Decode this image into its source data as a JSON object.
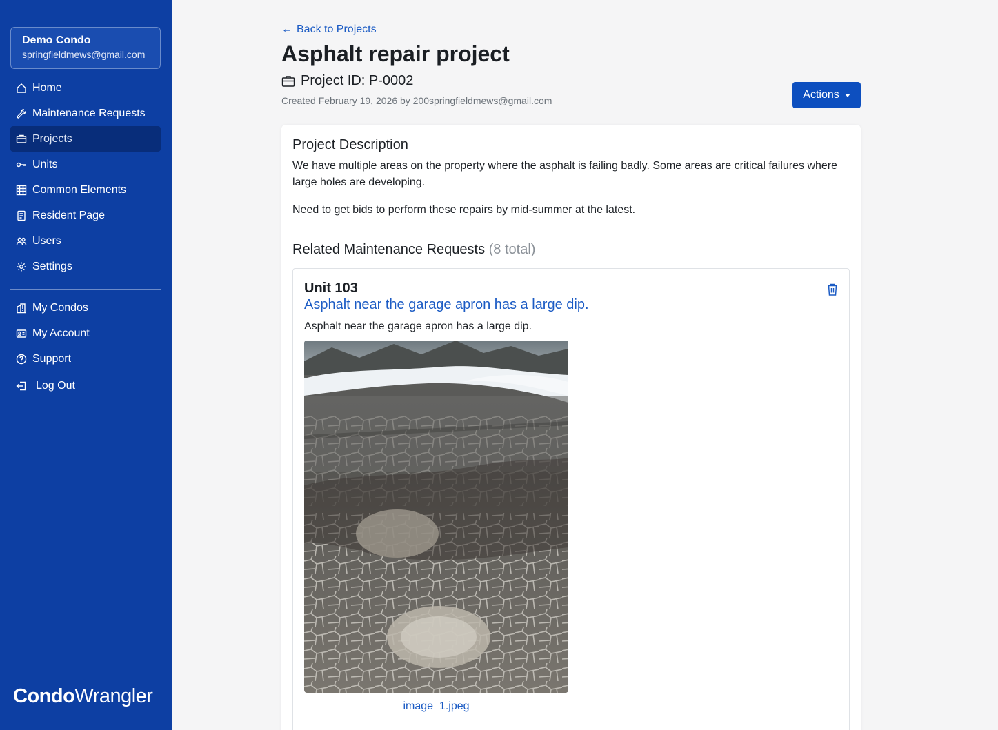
{
  "sidebar": {
    "condo_name": "Demo Condo",
    "condo_email": "springfieldmews@gmail.com",
    "nav_items": [
      {
        "label": "Home",
        "icon": "home-icon"
      },
      {
        "label": "Maintenance Requests",
        "icon": "wrench-icon"
      },
      {
        "label": "Projects",
        "icon": "folder-icon",
        "active": true
      },
      {
        "label": "Units",
        "icon": "key-icon"
      },
      {
        "label": "Common Elements",
        "icon": "building-grid-icon"
      },
      {
        "label": "Resident Page",
        "icon": "document-icon"
      },
      {
        "label": "Users",
        "icon": "users-icon"
      },
      {
        "label": "Settings",
        "icon": "gear-icon"
      }
    ],
    "nav_items_secondary": [
      {
        "label": "My Condos",
        "icon": "buildings-icon"
      },
      {
        "label": "My Account",
        "icon": "id-card-icon"
      },
      {
        "label": "Support",
        "icon": "question-circle-icon"
      },
      {
        "label": "Log Out",
        "icon": "logout-icon"
      }
    ],
    "logo_bold": "Condo",
    "logo_light": "Wrangler"
  },
  "header": {
    "back_label": "Back to Projects",
    "title": "Asphalt repair project",
    "project_id": "Project ID: P-0002",
    "created": "Created February 19, 2026 by 200springfieldmews@gmail.com",
    "actions_label": "Actions"
  },
  "description": {
    "heading": "Project Description",
    "paragraph_1": "We have multiple areas on the property where the asphalt is failing badly. Some areas are critical failures where large holes are developing.",
    "paragraph_2": "Need to get bids to perform these repairs by mid-summer at the latest."
  },
  "related": {
    "heading": "Related Maintenance Requests",
    "count": "(8 total)",
    "items": [
      {
        "unit": "Unit 103",
        "title": "Asphalt near the garage apron has a large dip.",
        "text": "Asphalt near the garage apron has a large dip.",
        "attachment": "image_1.jpeg"
      }
    ]
  },
  "colors": {
    "sidebar_bg": "#0d3fa3",
    "sidebar_active": "#082d7a",
    "primary": "#0d4fbf",
    "link": "#1b5bc4"
  }
}
